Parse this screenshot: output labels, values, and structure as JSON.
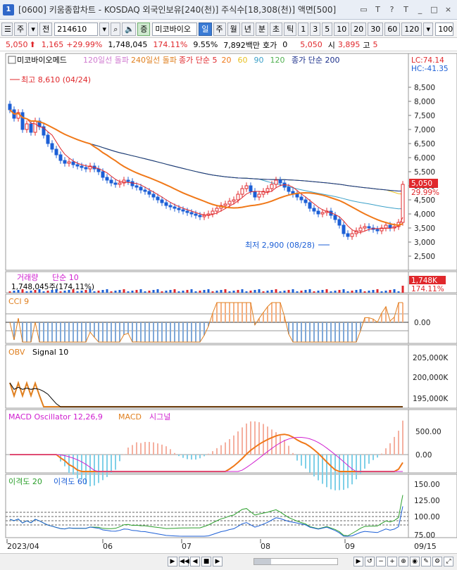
{
  "window": {
    "title": "[0600] 키움종합차트 - KOSDAQ 외국인보유[240(천)] 주식수[18,308(천)] 액면[500]",
    "icon_label": "1",
    "buttons": [
      "▭",
      "T",
      "?",
      "T",
      "_",
      "□",
      "×"
    ]
  },
  "toolbar": {
    "tab_stock": "주",
    "tab_prev": "전",
    "code": "214610",
    "sound_icon": "speaker-icon",
    "badge": "증",
    "stock_name": "미코바이오",
    "periods": [
      "일",
      "주",
      "월",
      "년",
      "분",
      "초",
      "틱"
    ],
    "active_period": "일",
    "numbers": [
      "1",
      "3",
      "5",
      "10",
      "20",
      "30",
      "60",
      "120"
    ],
    "view_count": "100"
  },
  "infobar": {
    "price": "5,050",
    "change": "1,165",
    "change_pct": "+29.99%",
    "volume": "1,748,045",
    "vol_ratio": "174.11%",
    "turnover": "9.55%",
    "amount": "7,892백만",
    "hoga_label": "호가",
    "hoga_value": "0",
    "hoga_price": "5,050",
    "open_label": "시",
    "open_value": "3,895",
    "high_label": "고",
    "high_value": "5"
  },
  "chart_data": [
    {
      "type": "line",
      "title": "미코바이오메드",
      "legend": [
        "120일선 돌파",
        "240일선 돌파",
        "종가 단순 5",
        "20",
        "60",
        "90",
        "120",
        "종가 단순 200"
      ],
      "lc_label": "LC:74.14",
      "hc_label": "HC:-41.35",
      "max_label": "최고 8,610 (04/24)",
      "min_label": "최저 2,900 (08/28)",
      "current_price_label": "5,050",
      "current_pct_label": "29.99%",
      "ylim": [
        2000,
        9000
      ],
      "yticks": [
        "8,500",
        "8,000",
        "7,500",
        "7,000",
        "6,500",
        "6,000",
        "5,500",
        "5,000",
        "4,500",
        "4,000",
        "3,500",
        "3,000",
        "2,500"
      ],
      "ytick_values": [
        8500,
        8000,
        7500,
        7000,
        6500,
        6000,
        5500,
        5000,
        4500,
        4000,
        3500,
        3000,
        2500
      ],
      "x_labels": [
        "2023/04",
        "06",
        "07",
        "08",
        "09",
        "09/15"
      ],
      "closes": [
        7700,
        7400,
        7600,
        7000,
        7200,
        6900,
        7300,
        7100,
        6800,
        6500,
        6300,
        6100,
        5900,
        5800,
        5850,
        5750,
        5700,
        5650,
        5600,
        5700,
        5600,
        5500,
        5300,
        5200,
        5100,
        5050,
        5100,
        5200,
        5150,
        5000,
        4950,
        4850,
        4800,
        4700,
        4600,
        4500,
        4400,
        4300,
        4250,
        4200,
        4150,
        4100,
        4050,
        4000,
        3950,
        3900,
        3950,
        4000,
        4100,
        4200,
        4300,
        4350,
        4450,
        4500,
        4700,
        4900,
        5000,
        4800,
        4600,
        4700,
        4800,
        4900,
        5050,
        5200,
        5100,
        4950,
        4800,
        4700,
        4600,
        4500,
        4400,
        4200,
        4100,
        4000,
        4050,
        4100,
        3950,
        3800,
        3600,
        3300,
        3200,
        3300,
        3400,
        3500,
        3550,
        3500,
        3450,
        3400,
        3500,
        3600,
        3500,
        3550,
        3700,
        5050
      ]
    },
    {
      "type": "bar",
      "title": "거래량",
      "legend": [
        "단순 10"
      ],
      "value_label": "1,748,045주(174.11%)",
      "current_label": "1,748K",
      "current_pct": "174.11%"
    },
    {
      "type": "line",
      "title": "CCI 9",
      "yticks": [
        "0.00"
      ]
    },
    {
      "type": "line",
      "title": "OBV",
      "legend": [
        "Signal 10"
      ],
      "yticks": [
        "205,000K",
        "200,000K",
        "195,000K"
      ]
    },
    {
      "type": "line",
      "title": "MACD Oscillator 12,26,9",
      "legend": [
        "MACD",
        "시그널"
      ],
      "yticks": [
        "500.00",
        "0.00"
      ]
    },
    {
      "type": "line",
      "title": "이격도 20",
      "legend": [
        "이격도 60"
      ],
      "yticks": [
        "150.00",
        "125.00",
        "100.00",
        "75.00"
      ]
    }
  ],
  "colors": {
    "up": "#e0282c",
    "down": "#1c5fd6",
    "ma5": "#e0282c",
    "ma20": "#f07818",
    "ma60": "#3aa0c8",
    "ma90": "#e8c020",
    "ma120": "#50b050",
    "ma200": "#1a2e8a",
    "panel_title": "#2b2b9a"
  }
}
